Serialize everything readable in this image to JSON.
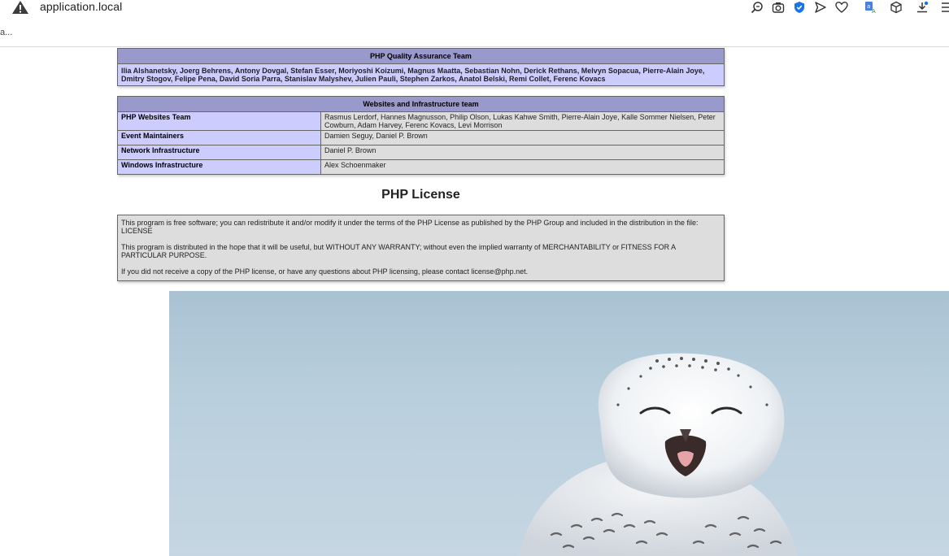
{
  "browser": {
    "url": "application.local",
    "subline": "a...",
    "icons": [
      "warning-icon",
      "zoom-icon",
      "screenshot-icon",
      "shield-icon",
      "send-icon",
      "heart-icon",
      "translate-icon",
      "cube-icon",
      "download-icon",
      "menu-icon"
    ]
  },
  "qa_team": {
    "header": "PHP Quality Assurance Team",
    "members": "Ilia Alshanetsky, Joerg Behrens, Antony Dovgal, Stefan Esser, Moriyoshi Koizumi, Magnus Maatta, Sebastian Nohn, Derick Rethans, Melvyn Sopacua, Pierre-Alain Joye, Dmitry Stogov, Felipe Pena, David Soria Parra, Stanislav Malyshev, Julien Pauli, Stephen Zarkos, Anatol Belski, Remi Collet, Ferenc Kovacs"
  },
  "infra_team": {
    "header": "Websites and Infrastructure team",
    "rows": [
      {
        "role": "PHP Websites Team",
        "names": "Rasmus Lerdorf, Hannes Magnusson, Philip Olson, Lukas Kahwe Smith, Pierre-Alain Joye, Kalle Sommer Nielsen, Peter Cowburn, Adam Harvey, Ferenc Kovacs, Levi Morrison"
      },
      {
        "role": "Event Maintainers",
        "names": "Damien Seguy, Daniel P. Brown"
      },
      {
        "role": "Network Infrastructure",
        "names": "Daniel P. Brown"
      },
      {
        "role": "Windows Infrastructure",
        "names": "Alex Schoenmaker"
      }
    ]
  },
  "license": {
    "title": "PHP License",
    "paragraphs": [
      "This program is free software; you can redistribute it and/or modify it under the terms of the PHP License as published by the PHP Group and included in the distribution in the file: LICENSE",
      "This program is distributed in the hope that it will be useful, but WITHOUT ANY WARRANTY; without even the implied warranty of MERCHANTABILITY or FITNESS FOR A PARTICULAR PURPOSE.",
      "If you did not receive a copy of the PHP license, or have any questions about PHP licensing, please contact license@php.net."
    ]
  }
}
